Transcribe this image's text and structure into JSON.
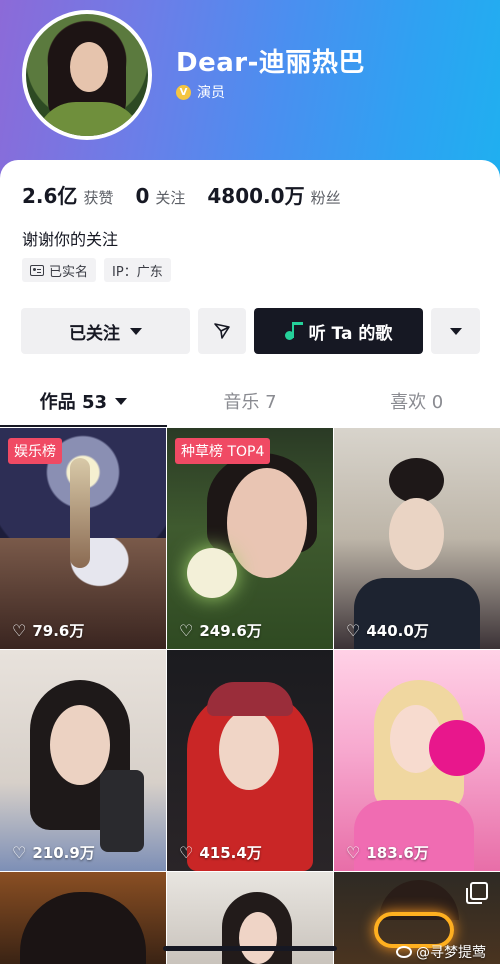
{
  "profile": {
    "name": "Dear-迪丽热巴",
    "verify_badge": "V",
    "verify_label": "演员",
    "bio": "谢谢你的关注",
    "tags": {
      "realname": "已实名",
      "ip": "IP：广东"
    }
  },
  "stats": {
    "likes_value": "2.6亿",
    "likes_label": "获赞",
    "following_value": "0",
    "following_label": "关注",
    "followers_value": "4800.0万",
    "followers_label": "粉丝"
  },
  "actions": {
    "followed_label": "已关注",
    "song_label": "听 Ta 的歌"
  },
  "tabs": {
    "works": "作品 53",
    "music": "音乐 7",
    "liked": "喜欢 0"
  },
  "videos": [
    {
      "badge": "娱乐榜",
      "likes": "79.6万"
    },
    {
      "badge": "种草榜 TOP4",
      "likes": "249.6万"
    },
    {
      "likes": "440.0万"
    },
    {
      "likes": "210.9万"
    },
    {
      "likes": "415.4万"
    },
    {
      "likes": "183.6万"
    }
  ],
  "watermark": "@寻梦提莺",
  "colors": {
    "accent_badge": "#f04a64",
    "music_icon": "#25d09a",
    "verify": "#f4c542"
  }
}
